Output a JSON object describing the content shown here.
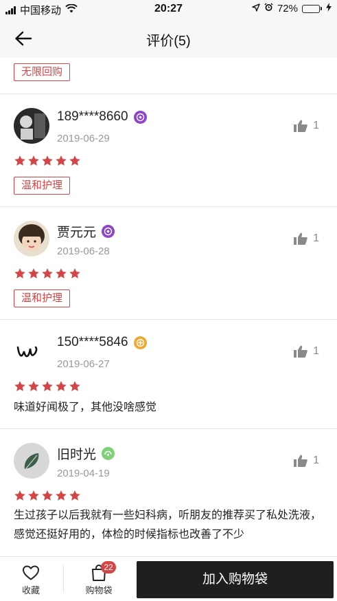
{
  "status_bar": {
    "carrier": "中国移动",
    "time": "20:27",
    "battery": "72%",
    "battery_level": 0.72
  },
  "nav": {
    "title": "评价(5)"
  },
  "top_tag": "无限回购",
  "reviews": [
    {
      "user": "189****8660",
      "date": "2019-06-29",
      "likes": "1",
      "rating": 5,
      "tag": "温和护理",
      "text": "",
      "level_color": "#8e44c9"
    },
    {
      "user": "贾元元",
      "date": "2019-06-28",
      "likes": "1",
      "rating": 5,
      "tag": "温和护理",
      "text": "",
      "level_color": "#8e44c9"
    },
    {
      "user": "150****5846",
      "date": "2019-06-27",
      "likes": "1",
      "rating": 5,
      "tag": "",
      "text": "味道好闻极了，其他没啥感觉",
      "level_color": "#f0a830"
    },
    {
      "user": "旧时光",
      "date": "2019-04-19",
      "likes": "1",
      "rating": 5,
      "tag": "",
      "text": "生过孩子以后我就有一些妇科病，听朋友的推荐买了私处洗液，感觉还挺好用的，体检的时候指标也改善了不少",
      "level_color": "#7ed07a"
    }
  ],
  "bottom_bar": {
    "favorite_label": "收藏",
    "cart_label": "购物袋",
    "cart_count": "22",
    "add_to_cart": "加入购物袋"
  },
  "colors": {
    "accent": "#d64545",
    "star": "#d64545",
    "button": "#1f1f1f"
  }
}
